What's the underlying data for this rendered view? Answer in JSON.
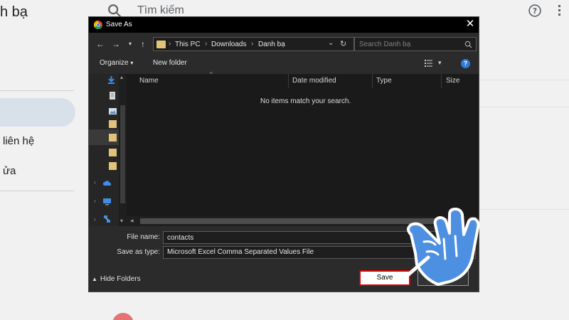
{
  "background": {
    "title": "h bạ",
    "search_placeholder": "Tìm kiếm",
    "sidebar_item_1": "liên hệ",
    "sidebar_item_2": "ửa"
  },
  "dialog": {
    "title": "Save As",
    "close_label": "✕",
    "breadcrumb": [
      "This PC",
      "Downloads",
      "Danh bạ"
    ],
    "search_placeholder": "Search Danh bạ",
    "toolbar": {
      "organize": "Organize",
      "new_folder": "New folder"
    },
    "columns": {
      "name": "Name",
      "date_modified": "Date modified",
      "type": "Type",
      "size": "Size"
    },
    "empty_message": "No items match your search.",
    "file_name_label": "File name:",
    "file_name_value": "contacts",
    "save_as_type_label": "Save as type:",
    "save_as_type_value": "Microsoft Excel Comma Separated Values File",
    "hide_folders": "Hide Folders",
    "save_button": "Save",
    "cancel_button": "ncel"
  },
  "colors": {
    "dialog_bg": "#2b2b2b",
    "content_bg": "#1a1a1a",
    "save_highlight": "#d80000",
    "hand_fill": "#4d8fe0"
  }
}
